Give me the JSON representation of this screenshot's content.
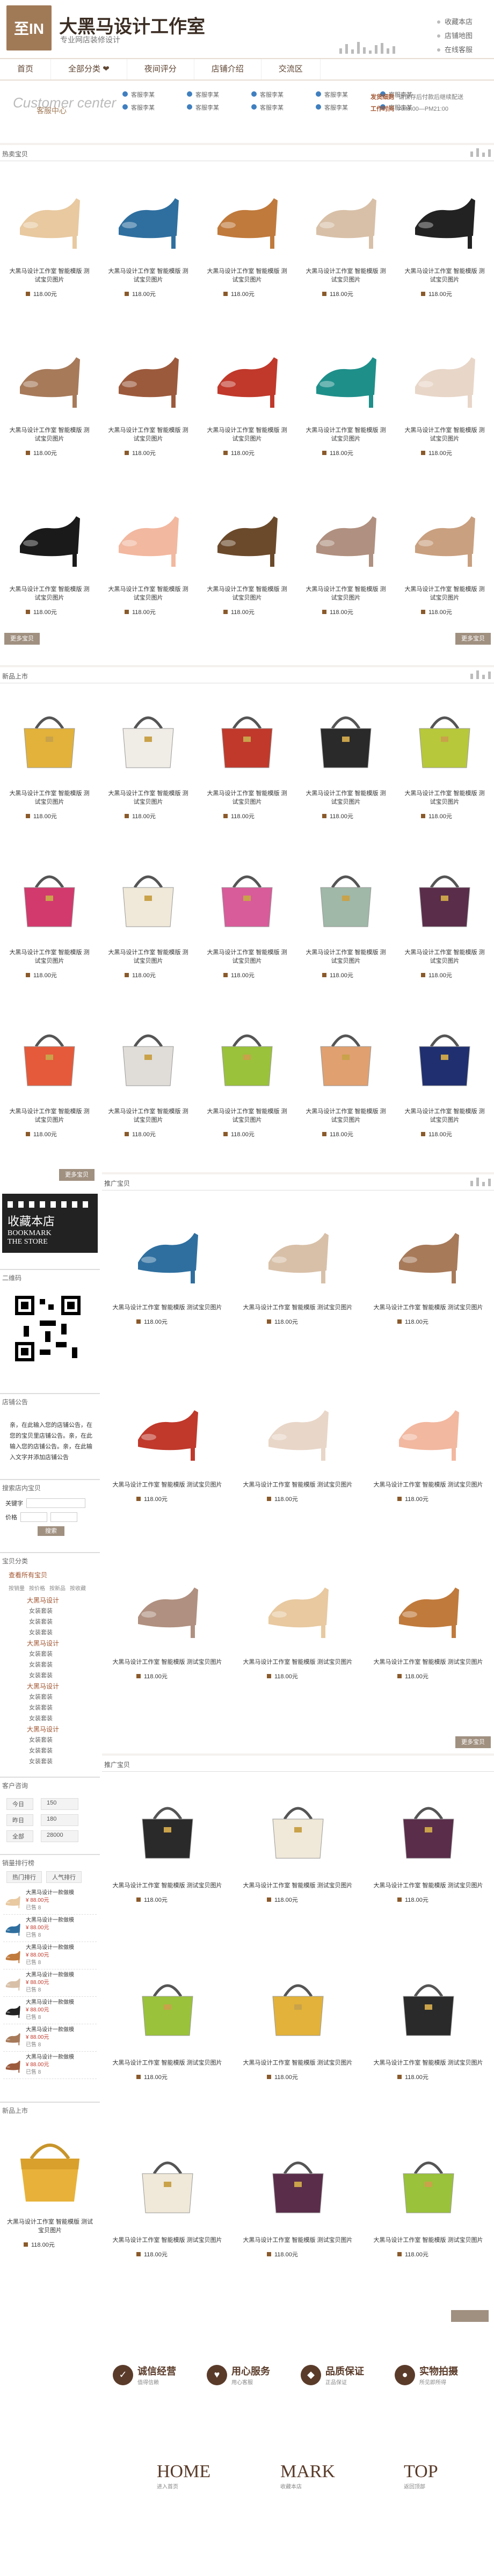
{
  "header": {
    "logo_text": "至IN",
    "title": "大黑马设计工作室",
    "subtitle": "专业网店装修设计",
    "links": [
      "收藏本店",
      "店铺地图",
      "在线客服"
    ]
  },
  "nav": [
    "首页",
    "全部分类 ❤",
    "夜间评分",
    "店铺介绍",
    "交流区"
  ],
  "service": {
    "title": "Customer center",
    "subtitle": "客服中心",
    "items": [
      "客服李某",
      "客服李某",
      "客服李某",
      "客服李某",
      "客服李某",
      "客服李某",
      "客服李某",
      "客服李某",
      "客服李某",
      "客服李某"
    ],
    "right": [
      {
        "k": "发货细则",
        "v": "请保存后付款后继续配送"
      },
      {
        "k": "工作时间",
        "v": "AM9:00—PM21:00"
      }
    ]
  },
  "sections": {
    "hot": "热卖宝贝",
    "new": "新品上市",
    "recommend": "推广宝贝",
    "recommend2": "推广宝贝",
    "more": "更多宝贝"
  },
  "product": {
    "desc": "大黑马设计工作室 智能模版 测试宝贝图片",
    "price": "118.00元"
  },
  "sidebar": {
    "bookmark": [
      "收藏本店",
      "BOOKMARK",
      "THE STORE"
    ],
    "qr_title": "二维码",
    "notice_title": "店铺公告",
    "notice": "亲，在此输入您的店铺公告，在您的宝贝里店铺公告。亲，在此输入您的店铺公告。亲，在此输入文字并添加店铺公告",
    "search_title": "搜索店内宝贝",
    "keyword_label": "关键字",
    "price_label": "价格",
    "search_btn": "搜索",
    "cat_title": "宝贝分类",
    "cat_view_all": "查看所有宝贝",
    "cat_sort": [
      "按销量",
      "按价格",
      "按新品",
      "按收藏"
    ],
    "cats": [
      "大黑马设计",
      "大黑马设计",
      "大黑马设计",
      "大黑马设计"
    ],
    "subcats": [
      "女装套装",
      "女装套装",
      "女装套装"
    ],
    "contact_title": "客户咨询",
    "contact": [
      {
        "k": "今日",
        "v": "150"
      },
      {
        "k": "昨日",
        "v": "180"
      },
      {
        "k": "全部",
        "v": "28000"
      }
    ],
    "rank_title": "销量排行榜",
    "rank_tabs": [
      "热门排行",
      "人气排行"
    ],
    "rank_item": "大黑马设计一款做模",
    "rank_price": "¥ 88.00元",
    "rank_sold": "已售 8",
    "new_title": "新品上市",
    "new_price": "118.00元"
  },
  "footer": {
    "svc": [
      {
        "t": "诚信经营",
        "s": "值得信赖"
      },
      {
        "t": "用心服务",
        "s": "用心客服"
      },
      {
        "t": "品质保证",
        "s": "正品保证"
      },
      {
        "t": "实物拍摄",
        "s": "所见即所得"
      }
    ],
    "home": [
      "HOME",
      "MARK",
      "TOP"
    ],
    "home_sub": [
      "进入首页",
      "收藏本店",
      "返回顶部"
    ]
  }
}
